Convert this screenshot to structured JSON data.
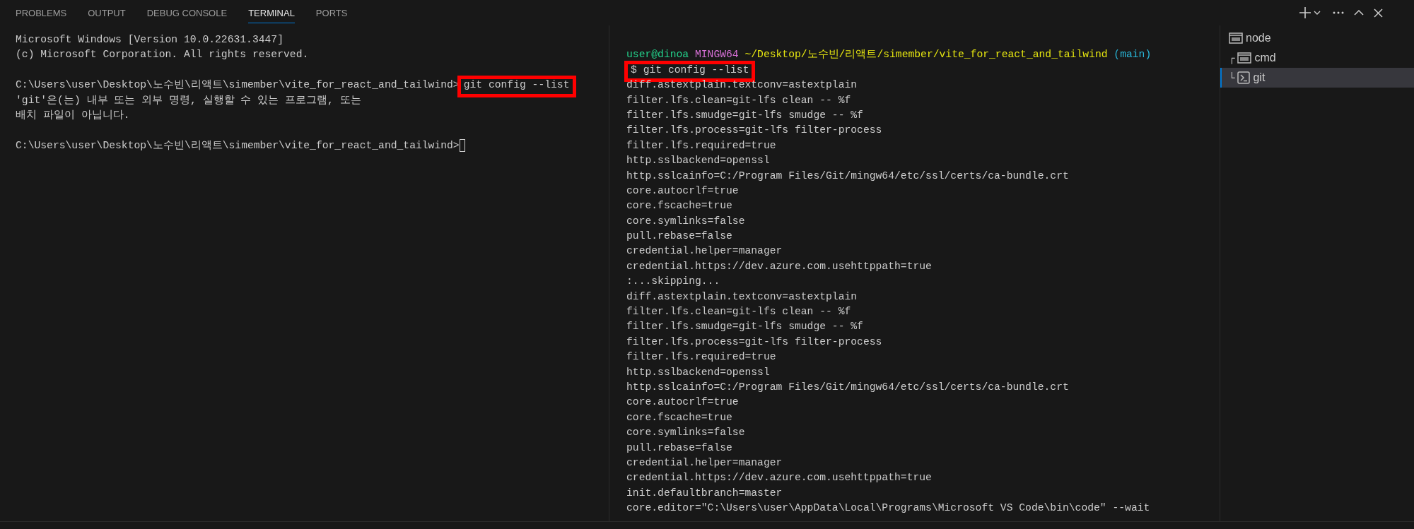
{
  "panel_tabs": [
    {
      "label": "PROBLEMS",
      "selected": false
    },
    {
      "label": "OUTPUT",
      "selected": false
    },
    {
      "label": "DEBUG CONSOLE",
      "selected": false
    },
    {
      "label": "TERMINAL",
      "selected": true
    },
    {
      "label": "PORTS",
      "selected": false
    }
  ],
  "left_terminal": {
    "lines": [
      {
        "kind": "text",
        "segments": [
          {
            "text": "Microsoft Windows [Version 10.0.22631.3447]",
            "highlighted": false
          }
        ]
      },
      {
        "kind": "text",
        "segments": [
          {
            "text": "(c) Microsoft Corporation. All rights reserved.",
            "highlighted": false
          }
        ]
      },
      {
        "kind": "blank"
      },
      {
        "kind": "text",
        "segments": [
          {
            "text": "C:\\Users\\user\\Desktop\\노수빈\\리액트\\simember\\vite_for_react_and_tailwind>",
            "highlighted": false
          },
          {
            "text": "git config --list",
            "highlighted": true
          }
        ]
      },
      {
        "kind": "text",
        "segments": [
          {
            "text": "'git'은(는) 내부 또는 외부 명령, 실행할 수 있는 프로그램, 또는",
            "highlighted": false
          }
        ]
      },
      {
        "kind": "text",
        "segments": [
          {
            "text": "배치 파일이 아닙니다.",
            "highlighted": false
          }
        ]
      },
      {
        "kind": "blank"
      },
      {
        "kind": "text",
        "cursor": true,
        "segments": [
          {
            "text": "C:\\Users\\user\\Desktop\\노수빈\\리액트\\simember\\vite_for_react_and_tailwind>",
            "highlighted": false
          }
        ]
      }
    ]
  },
  "right_terminal": {
    "lines": [
      {
        "kind": "blank"
      },
      {
        "kind": "text",
        "segments": [
          {
            "text": "user@dinoa",
            "color": "#23d18b",
            "highlighted": false
          },
          {
            "text": "MINGW64",
            "color": "#d670d6",
            "highlighted": false
          },
          {
            "text": "~/Desktop/노수빈/리액트/simember/vite_for_react_and_tailwind",
            "color": "#e5e510",
            "highlighted": false
          },
          {
            "text": "(main)",
            "color": "#29b8db",
            "highlighted": false
          }
        ]
      },
      {
        "kind": "text",
        "segments": [
          {
            "text": "$ git config --list",
            "highlighted": true
          }
        ]
      },
      {
        "kind": "text",
        "segments": [
          {
            "text": "diff.astextplain.textconv=astextplain",
            "highlighted": false
          }
        ]
      },
      {
        "kind": "text",
        "segments": [
          {
            "text": "filter.lfs.clean=git-lfs clean -- %f",
            "highlighted": false
          }
        ]
      },
      {
        "kind": "text",
        "segments": [
          {
            "text": "filter.lfs.smudge=git-lfs smudge -- %f",
            "highlighted": false
          }
        ]
      },
      {
        "kind": "text",
        "segments": [
          {
            "text": "filter.lfs.process=git-lfs filter-process",
            "highlighted": false
          }
        ]
      },
      {
        "kind": "text",
        "segments": [
          {
            "text": "filter.lfs.required=true",
            "highlighted": false
          }
        ]
      },
      {
        "kind": "text",
        "segments": [
          {
            "text": "http.sslbackend=openssl",
            "highlighted": false
          }
        ]
      },
      {
        "kind": "text",
        "segments": [
          {
            "text": "http.sslcainfo=C:/Program Files/Git/mingw64/etc/ssl/certs/ca-bundle.crt",
            "highlighted": false
          }
        ]
      },
      {
        "kind": "text",
        "segments": [
          {
            "text": "core.autocrlf=true",
            "highlighted": false
          }
        ]
      },
      {
        "kind": "text",
        "segments": [
          {
            "text": "core.fscache=true",
            "highlighted": false
          }
        ]
      },
      {
        "kind": "text",
        "segments": [
          {
            "text": "core.symlinks=false",
            "highlighted": false
          }
        ]
      },
      {
        "kind": "text",
        "segments": [
          {
            "text": "pull.rebase=false",
            "highlighted": false
          }
        ]
      },
      {
        "kind": "text",
        "segments": [
          {
            "text": "credential.helper=manager",
            "highlighted": false
          }
        ]
      },
      {
        "kind": "text",
        "segments": [
          {
            "text": "credential.https://dev.azure.com.usehttppath=true",
            "highlighted": false
          }
        ]
      },
      {
        "kind": "text",
        "segments": [
          {
            "text": ":...skipping...",
            "highlighted": false
          }
        ]
      },
      {
        "kind": "text",
        "segments": [
          {
            "text": "diff.astextplain.textconv=astextplain",
            "highlighted": false
          }
        ]
      },
      {
        "kind": "text",
        "segments": [
          {
            "text": "filter.lfs.clean=git-lfs clean -- %f",
            "highlighted": false
          }
        ]
      },
      {
        "kind": "text",
        "segments": [
          {
            "text": "filter.lfs.smudge=git-lfs smudge -- %f",
            "highlighted": false
          }
        ]
      },
      {
        "kind": "text",
        "segments": [
          {
            "text": "filter.lfs.process=git-lfs filter-process",
            "highlighted": false
          }
        ]
      },
      {
        "kind": "text",
        "segments": [
          {
            "text": "filter.lfs.required=true",
            "highlighted": false
          }
        ]
      },
      {
        "kind": "text",
        "segments": [
          {
            "text": "http.sslbackend=openssl",
            "highlighted": false
          }
        ]
      },
      {
        "kind": "text",
        "segments": [
          {
            "text": "http.sslcainfo=C:/Program Files/Git/mingw64/etc/ssl/certs/ca-bundle.crt",
            "highlighted": false
          }
        ]
      },
      {
        "kind": "text",
        "segments": [
          {
            "text": "core.autocrlf=true",
            "highlighted": false
          }
        ]
      },
      {
        "kind": "text",
        "segments": [
          {
            "text": "core.fscache=true",
            "highlighted": false
          }
        ]
      },
      {
        "kind": "text",
        "segments": [
          {
            "text": "core.symlinks=false",
            "highlighted": false
          }
        ]
      },
      {
        "kind": "text",
        "segments": [
          {
            "text": "pull.rebase=false",
            "highlighted": false
          }
        ]
      },
      {
        "kind": "text",
        "segments": [
          {
            "text": "credential.helper=manager",
            "highlighted": false
          }
        ]
      },
      {
        "kind": "text",
        "segments": [
          {
            "text": "credential.https://dev.azure.com.usehttppath=true",
            "highlighted": false
          }
        ]
      },
      {
        "kind": "text",
        "segments": [
          {
            "text": "init.defaultbranch=master",
            "highlighted": false
          }
        ]
      },
      {
        "kind": "text",
        "segments": [
          {
            "text": "core.editor=\"C:\\Users\\user\\AppData\\Local\\Programs\\Microsoft VS Code\\bin\\code\" --wait",
            "highlighted": false
          }
        ]
      }
    ]
  },
  "terminal_list": [
    {
      "label": "node",
      "kind": "cmd",
      "selected": false
    },
    {
      "label": "cmd",
      "kind": "cmd",
      "branch": "┌",
      "selected": false
    },
    {
      "label": "git",
      "kind": "bash",
      "branch": "└",
      "selected": true
    }
  ]
}
